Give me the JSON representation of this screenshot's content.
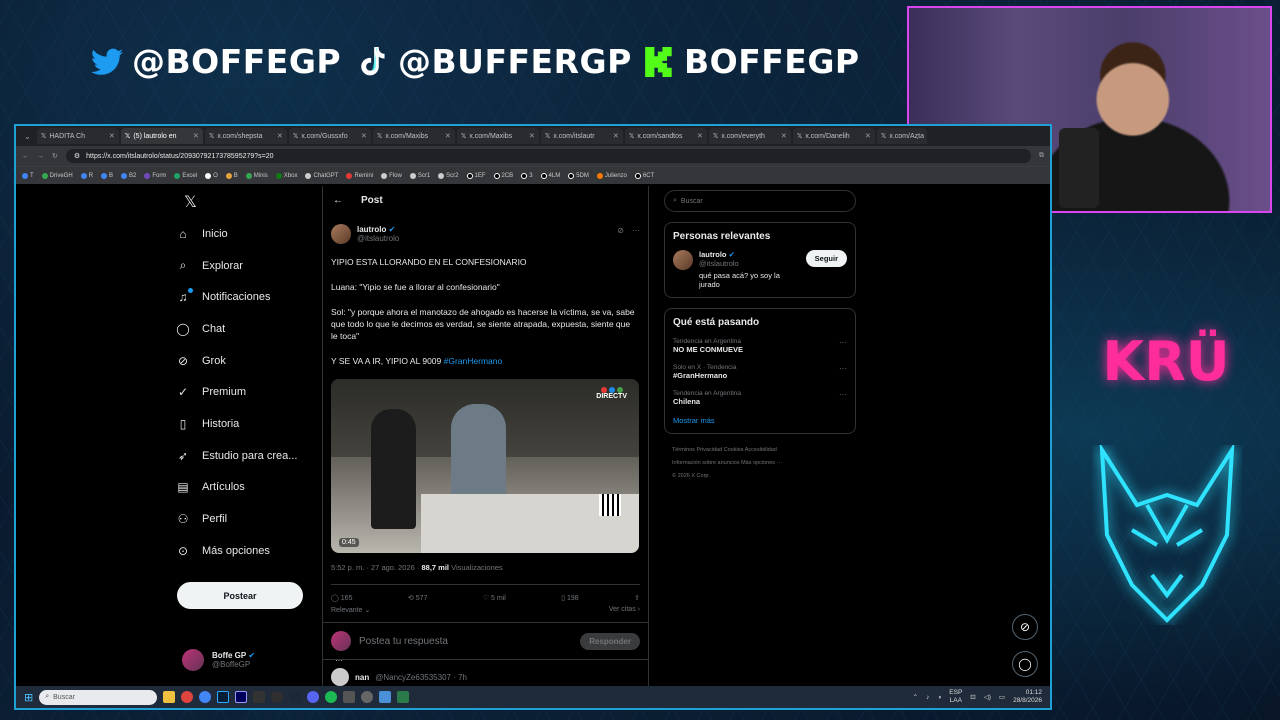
{
  "overlay": {
    "twitter_handle": "@BOFFEGP",
    "tiktok_handle": "@BUFFERGP",
    "kick_handle": "BOFFEGP",
    "team_logo": "KRÜ"
  },
  "browser": {
    "tabs": [
      {
        "label": "HADITA Ch"
      },
      {
        "label": "(5) lautrolo en"
      },
      {
        "label": "x.com/shepsta"
      },
      {
        "label": "x.com/Gussxfo"
      },
      {
        "label": "x.com/Maxibs"
      },
      {
        "label": "x.com/Maxibs"
      },
      {
        "label": "x.com/itslautr"
      },
      {
        "label": "x.com/sandtos"
      },
      {
        "label": "x.com/everyth"
      },
      {
        "label": "x.com/Danelih"
      },
      {
        "label": "x.com/Aȥta"
      }
    ],
    "url": "https://x.com/itslautrolo/status/2093079217378595279?s=20",
    "bookmarks": [
      "T",
      "DriveGH",
      "R",
      "B",
      "B2",
      "Form",
      "Excel",
      "O",
      "B",
      "Minis",
      "Xbox",
      "ChatGPT",
      "Remini",
      "Flow",
      "Scr1",
      "Scr2",
      "1EF",
      "2CB",
      "3",
      "4LM",
      "5DM",
      "Julienzo",
      "6CT"
    ]
  },
  "nav": {
    "items": [
      {
        "label": "Inicio",
        "icon": "home-icon",
        "glyph": "⌂"
      },
      {
        "label": "Explorar",
        "icon": "search-icon",
        "glyph": "⌕"
      },
      {
        "label": "Notificaciones",
        "icon": "bell-icon",
        "glyph": "🔔"
      },
      {
        "label": "Chat",
        "icon": "chat-icon",
        "glyph": "◯"
      },
      {
        "label": "Grok",
        "icon": "grok-icon",
        "glyph": "⊘"
      },
      {
        "label": "Premium",
        "icon": "premium-icon",
        "glyph": "✓"
      },
      {
        "label": "Historia",
        "icon": "bookmark-icon",
        "glyph": "⚑"
      },
      {
        "label": "Estudio para crea...",
        "icon": "rocket-icon",
        "glyph": "➶"
      },
      {
        "label": "Artículos",
        "icon": "article-icon",
        "glyph": "▤"
      },
      {
        "label": "Perfil",
        "icon": "profile-icon",
        "glyph": "⚇"
      },
      {
        "label": "Más opciones",
        "icon": "more-icon",
        "glyph": "⋯"
      }
    ],
    "post_button": "Postear",
    "user_name": "Boffe GP",
    "user_handle": "@BoffeGP"
  },
  "post": {
    "header": "Post",
    "author_name": "lautrolo",
    "author_handle": "@itslautrolo",
    "line1": "YIPIO ESTA LLORANDO EN EL CONFESIONARIO",
    "line2": "Luana: \"Yipio se fue a llorar al confesionario\"",
    "line3": "Sol: \"y porque ahora el manotazo de ahogado es hacerse la víctima, se va, sabe que todo lo que le decimos es verdad, se siente atrapada, expuesta, siente que le toca\"",
    "line4": "Y SE VA A IR, YIPIO AL 9009",
    "hashtag": "#GranHermano",
    "video_time": "0:45",
    "video_badge": "DIRECTV",
    "timestamp": "5:52 p. m. · 27 ago. 2026 · ",
    "views": "88,7 mil",
    "views_label": "Visualizaciones",
    "replies": "165",
    "reposts": "577",
    "likes": "5 mil",
    "bookmarks": "198",
    "sort_label": "Relevante",
    "quotes_label": "Ver citas",
    "reply_placeholder": "Postea tu respuesta",
    "reply_button": "Responder",
    "next_reply_name": "nan",
    "next_reply_handle": "@NancyZe63535307 · 7h"
  },
  "sidebar": {
    "search_placeholder": "Buscar",
    "relevant_title": "Personas relevantes",
    "relevant_name": "lautrolo",
    "relevant_handle": "@itslautrolo",
    "relevant_bio": "qué pasa acá? yo soy la jurado",
    "follow_button": "Seguir",
    "trends_title": "Qué está pasando",
    "trends": [
      {
        "context": "Tendencia en Argentina",
        "name": "NO ME CONMUEVE"
      },
      {
        "context": "Solo en X · Tendencia",
        "name": "#GranHermano"
      },
      {
        "context": "Tendencia en Argentina",
        "name": "Chilena"
      }
    ],
    "show_more": "Mostrar más",
    "footer1": "Términos   Privacidad   Cookies   Accesibilidad",
    "footer2": "Información sobre anuncios   Más opciones ···",
    "footer3": "© 2026 X Corp."
  },
  "taskbar": {
    "search_placeholder": "Buscar",
    "lang1": "ESP",
    "lang2": "LAA",
    "time": "01:12",
    "date": "28/8/2026"
  }
}
